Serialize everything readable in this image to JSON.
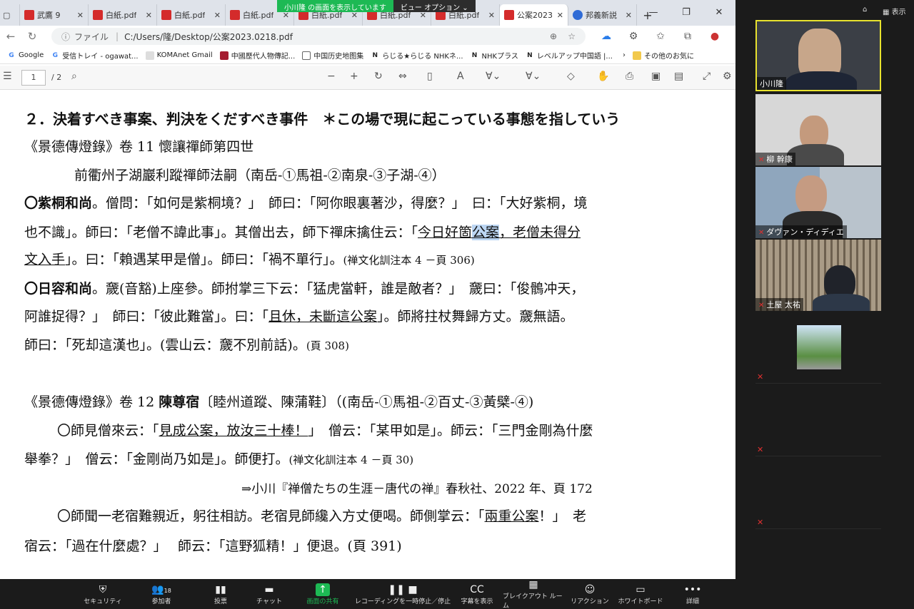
{
  "browser": {
    "tabs": [
      {
        "label": "武鷹 9",
        "icon": "pdf-icon"
      },
      {
        "label": "白紙.pdf",
        "icon": "pdf-icon"
      },
      {
        "label": "白紙.pdf",
        "icon": "pdf-icon"
      },
      {
        "label": "白紙.pdf",
        "icon": "pdf-icon"
      },
      {
        "label": "白紙.pdf",
        "icon": "pdf-icon"
      },
      {
        "label": "白紙.pdf",
        "icon": "pdf-icon"
      },
      {
        "label": "白紙.pdf",
        "icon": "pdf-icon"
      },
      {
        "label": "公案2023",
        "icon": "pdf-icon"
      },
      {
        "label": "邦義新説",
        "icon": "globe-icon"
      }
    ],
    "new_tab": "+",
    "share_banner": "小川隆 の画面を表示しています",
    "view_option": "ビュー オプション",
    "address": {
      "label": "ファイル",
      "url": "C:/Users/隆/Desktop/公案2023.0218.pdf"
    },
    "bookmarks": [
      "Google",
      "受信トレイ - ogawat...",
      "KOMAnet Gmail",
      "中國歷代人物傳記...",
      "中国历史地图集",
      "らじる★らじる NHKネ...",
      "NHKプラス",
      "レベルアップ中国語 |...",
      "その他のお気に"
    ],
    "pdf_toolbar": {
      "page": "1",
      "total": "/ 2"
    }
  },
  "doc": {
    "heading": "２．決着すべき事案、判決をくだすべき事件",
    "heading_note": "＊この場で現に起こっている事態を指していう",
    "src1": "《景德傳燈錄》卷 11 懷讓禪師第四世",
    "lineage1": "前衢州子湖巖利蹤禪師法嗣（南岳-①馬祖-②南泉-③子湖-④）",
    "p1_l1_a": "〇紫桐和尚",
    "p1_l1_b": "。僧問：「如何是紫桐境？」　師曰：「阿你眼裏著沙，得麼？」　曰：「大好紫桐，境",
    "p1_l2_a": "也不識」。師曰：「老僧不諱此事」。其僧出去，師下禪床擒住云：「",
    "p1_l2_u1": "今日好箇",
    "p1_l2_hl": "公案",
    "p1_l2_u2": "，老僧未得分",
    "p1_l3_u": "文入手",
    "p1_l3_b": "」。曰：「賴遇某甲是僧」。師曰：「禍不單行」。",
    "p1_ref": "(禅文化訓注本 4 －頁 306)",
    "p2_l1_a": "〇日容和尚",
    "p2_l1_b": "。奯(音豁)上座參。師拊掌三下云：「猛虎當軒，誰是敵者？」　奯曰：「俊鶻冲天，",
    "p2_l2_a": "阿誰捉得？」　師曰：「彼此難當」。曰：「",
    "p2_l2_u": "且休，未斷這公案",
    "p2_l2_b": "」。師將拄杖舞歸方丈。奯無語。",
    "p2_l3_a": "師曰：「死却這漢也」。(雲山云：奯不別前話)。",
    "p2_ref": "(頁 308)",
    "src2_a": "《景德傳燈錄》卷 12 ",
    "src2_b": "陳尊宿",
    "src2_c": "〔睦州道蹤、陳蒲鞋〕（(南岳-①馬祖-②百丈-③黃檗-④)",
    "p3_l1_a": "〇師見僧來云：「",
    "p3_l1_u": "見成公案，放汝三十棒！",
    "p3_l1_b": "」　僧云：「某甲如是」。師云：「三門金剛為什麼",
    "p3_l2_a": "舉拳？」　僧云：「金剛尚乃如是」。師便打。",
    "p3_ref": "(禅文化訓注本 4 －頁 30)",
    "p3_cite": "⇒小川『禅僧たちの生涯－唐代の禅』春秋社、2022 年、頁 172",
    "p4_l1_a": "〇師聞一老宿難親近，躬往相訪。老宿見師纔入方丈便喝。師側掌云：「",
    "p4_l1_u": "兩重公案",
    "p4_l1_b": "！」　老",
    "p4_l2": "宿云：「過在什麼處？」　 師云：「這野狐精！」便退。(頁 391)"
  },
  "zoom": {
    "top_label": "表示",
    "participants": [
      {
        "name": "小川隆"
      },
      {
        "name": "柳 幹康"
      },
      {
        "name": "ダヴァン・ディディエ"
      },
      {
        "name": "土屋 太祐"
      }
    ],
    "toolbar": [
      {
        "label": "セキュリティ",
        "icon": "shield-icon"
      },
      {
        "label": "参加者",
        "icon": "people-icon",
        "count": "18"
      },
      {
        "label": "投票",
        "icon": "poll-icon"
      },
      {
        "label": "チャット",
        "icon": "chat-icon"
      },
      {
        "label": "画面の共有",
        "icon": "share-screen-icon"
      },
      {
        "label": "レコーディングを一時停止／停止",
        "icon": "record-icon"
      },
      {
        "label": "字幕を表示",
        "icon": "captions-icon"
      },
      {
        "label": "ブレイクアウト ルーム",
        "icon": "breakout-icon"
      },
      {
        "label": "リアクション",
        "icon": "reaction-icon"
      },
      {
        "label": "ホワイトボード",
        "icon": "whiteboard-icon"
      },
      {
        "label": "詳細",
        "icon": "more-icon"
      }
    ]
  },
  "colors": {
    "share_green": "#1db954",
    "active_speaker": "#e8e22e",
    "mute_red": "#e03030",
    "selection": "#bcd6f3"
  }
}
